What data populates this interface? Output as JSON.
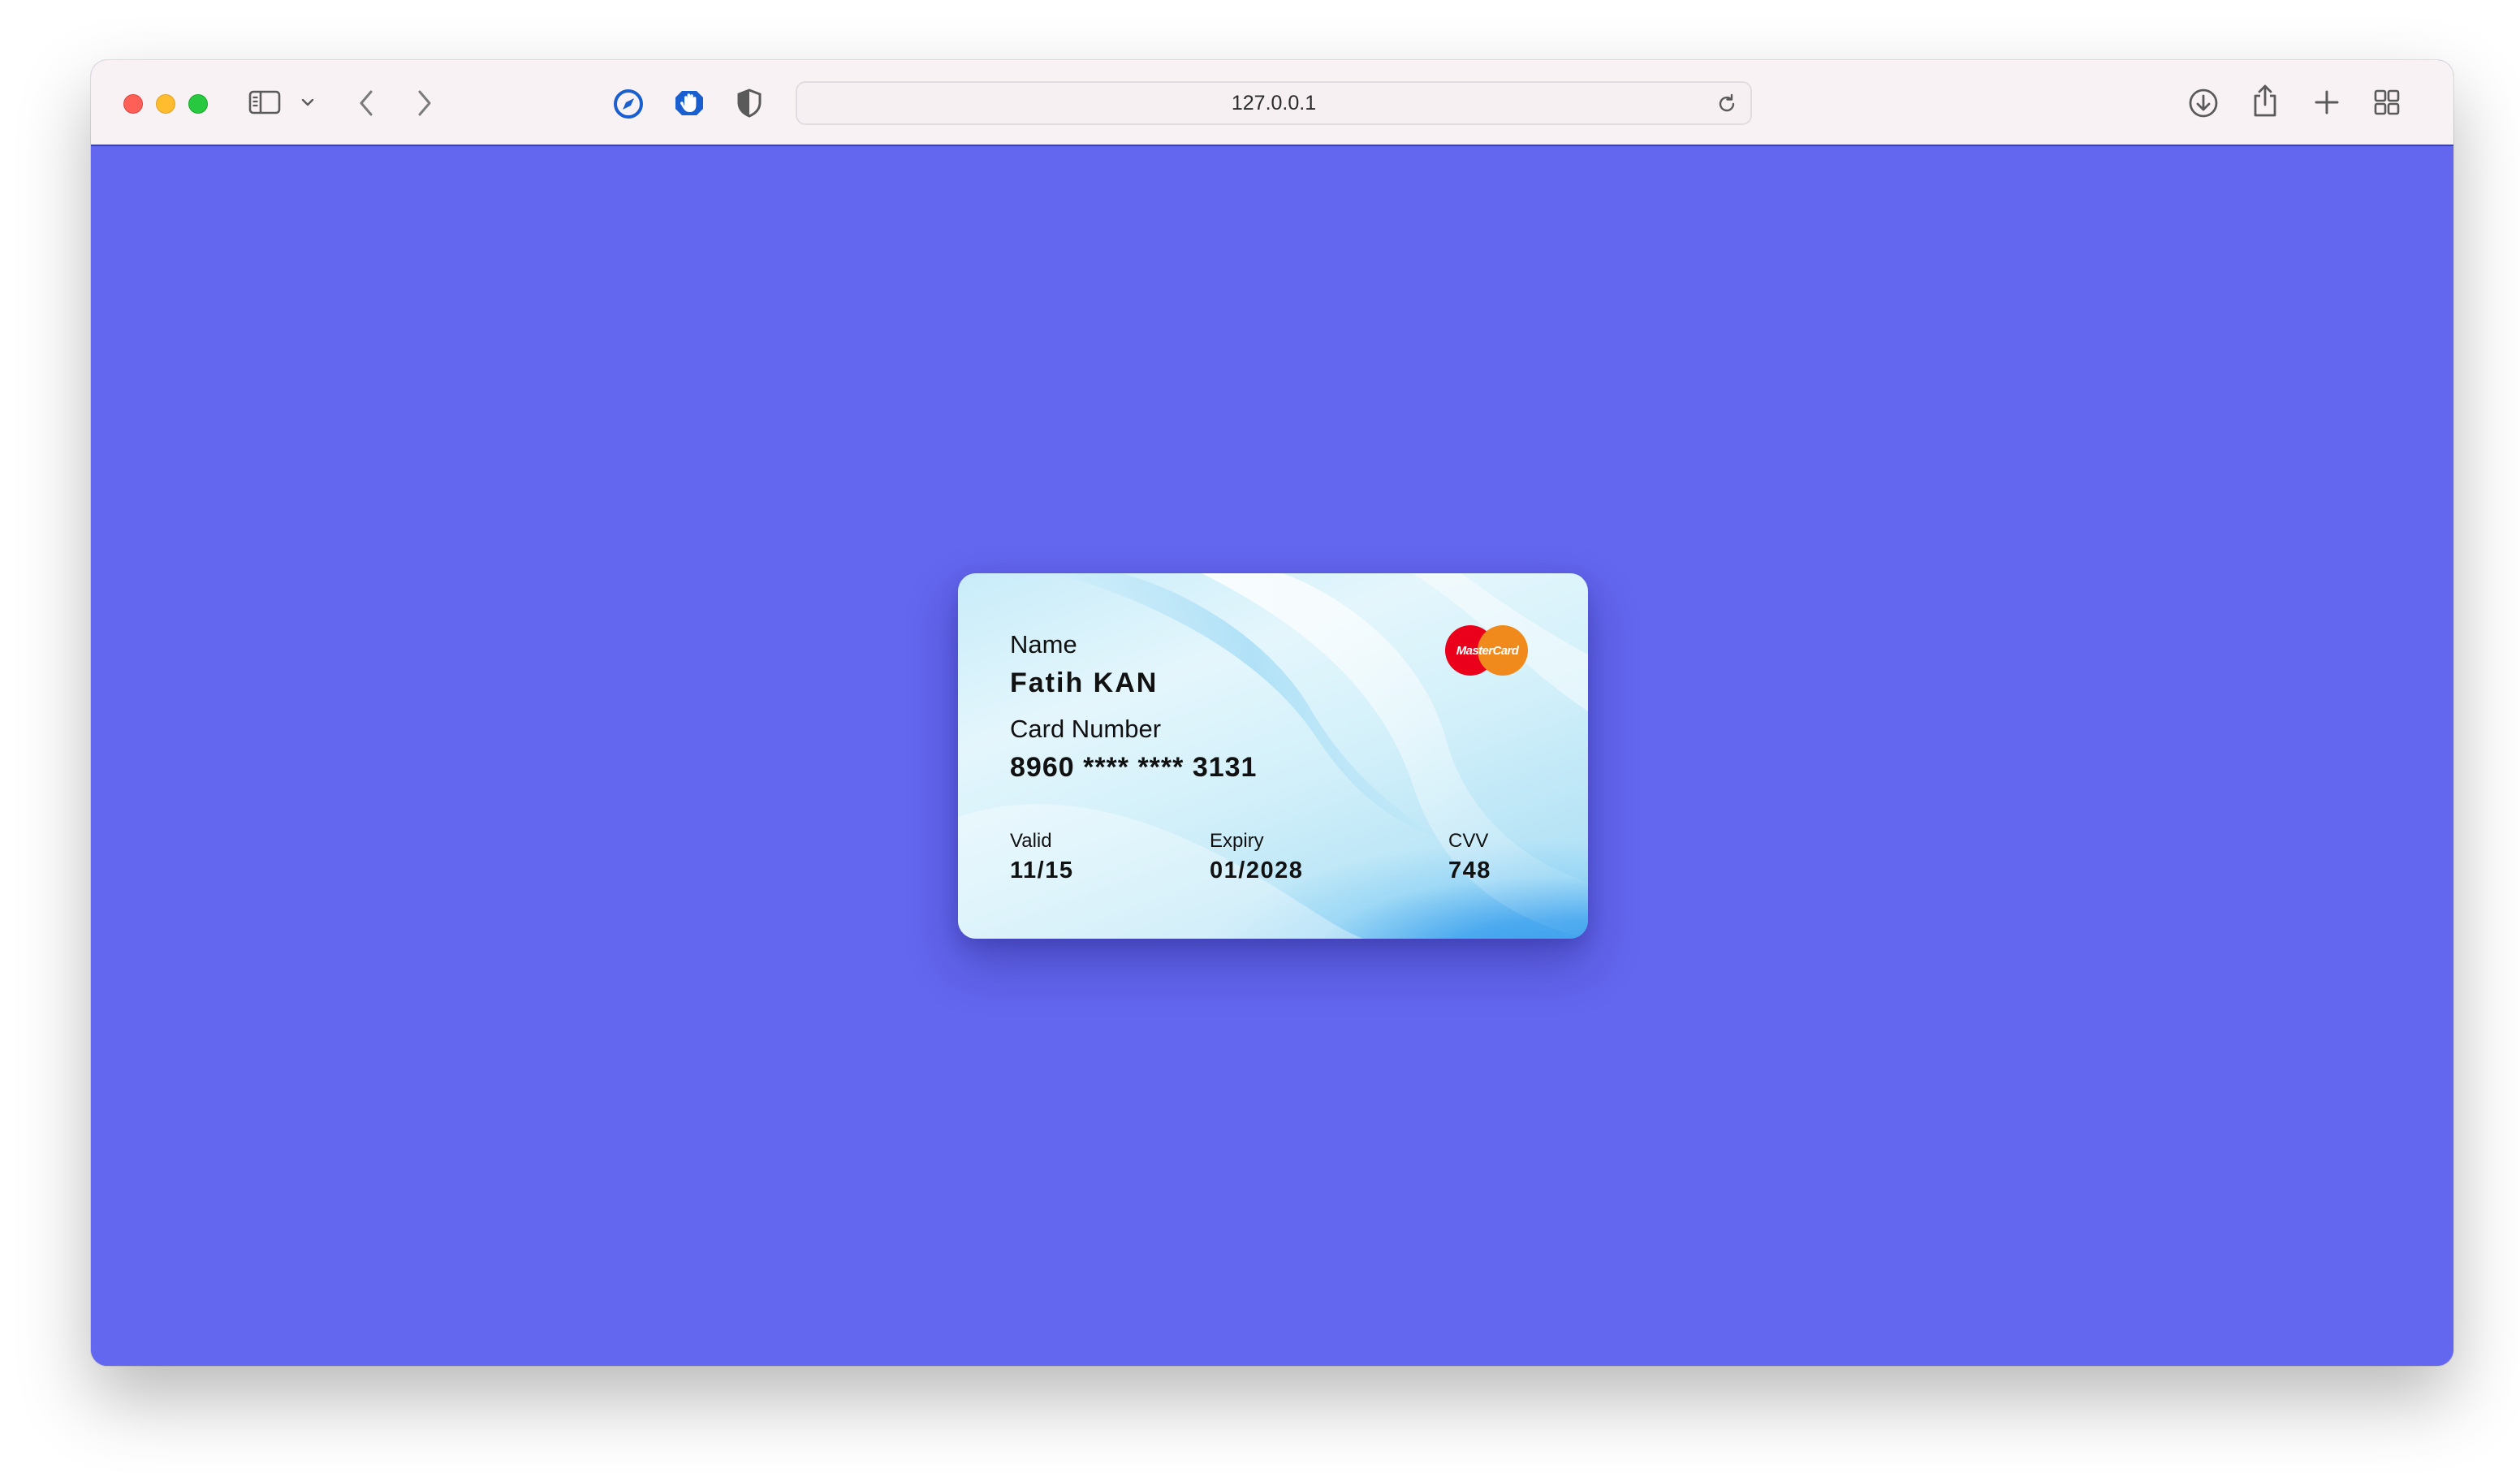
{
  "browser": {
    "url": "127.0.0.1",
    "icons": {
      "sidebar": "sidebar-icon",
      "sidebar_menu": "chevron-down-icon",
      "back": "back-icon",
      "forward": "forward-icon",
      "extension_1": "compass-extension-icon",
      "extension_2": "hand-extension-icon",
      "extension_3": "shield-extension-icon",
      "reload": "reload-icon",
      "downloads": "download-icon",
      "share": "share-icon",
      "new_tab": "plus-icon",
      "tab_overview": "tab-overview-icon"
    }
  },
  "card": {
    "name_label": "Name",
    "name_value": "Fatih KAN",
    "number_label": "Card Number",
    "number_value": "8960 **** **** 3131",
    "valid_label": "Valid",
    "valid_value": "11/15",
    "expiry_label": "Expiry",
    "expiry_value": "01/2028",
    "cvv_label": "CVV",
    "cvv_value": "748",
    "brand": "MasterCard"
  },
  "colors": {
    "page_background": "#6366ee",
    "toolbar": "#f9f2f5",
    "mastercard_red": "#eb001b",
    "mastercard_orange": "#f08a1c"
  }
}
